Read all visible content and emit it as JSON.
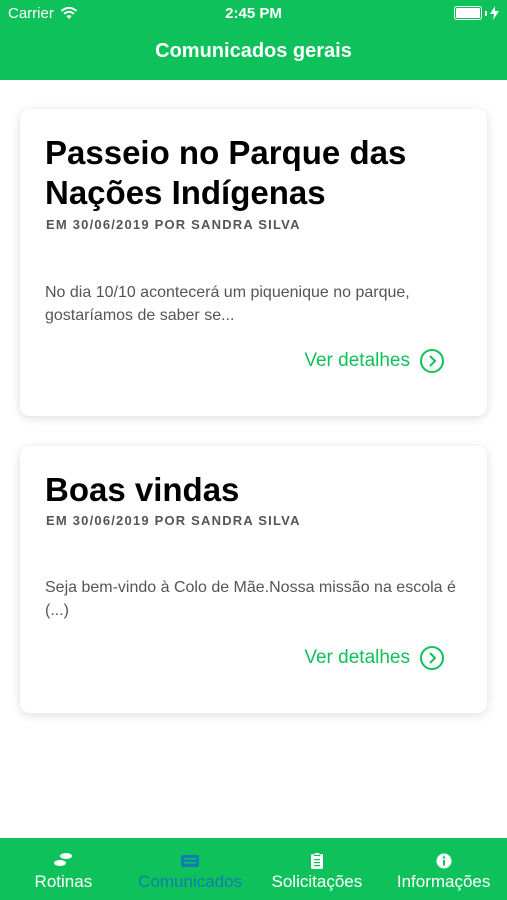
{
  "status": {
    "carrier": "Carrier",
    "time": "2:45 PM"
  },
  "nav": {
    "title": "Comunicados gerais"
  },
  "cards": [
    {
      "title": "Passeio no Parque das Nações Indígenas",
      "meta": "EM 30/06/2019 POR SANDRA SILVA",
      "body": " No dia 10/10 acontecerá um piquenique no parque, gostaríamos de saber se...",
      "link": "Ver detalhes"
    },
    {
      "title": "Boas vindas",
      "meta": "EM 30/06/2019 POR SANDRA SILVA",
      "body": " Seja bem-vindo à Colo de Mãe.Nossa missão na escola é (...)",
      "link": "Ver detalhes"
    }
  ],
  "tabs": [
    {
      "label": "Rotinas",
      "icon": "routine-icon"
    },
    {
      "label": "Comunicados",
      "icon": "message-icon",
      "active": true
    },
    {
      "label": "Solicitações",
      "icon": "clipboard-icon"
    },
    {
      "label": "Informações",
      "icon": "info-icon"
    }
  ],
  "colors": {
    "primary": "#0fc15a",
    "active_tab": "#0f7fb0"
  }
}
